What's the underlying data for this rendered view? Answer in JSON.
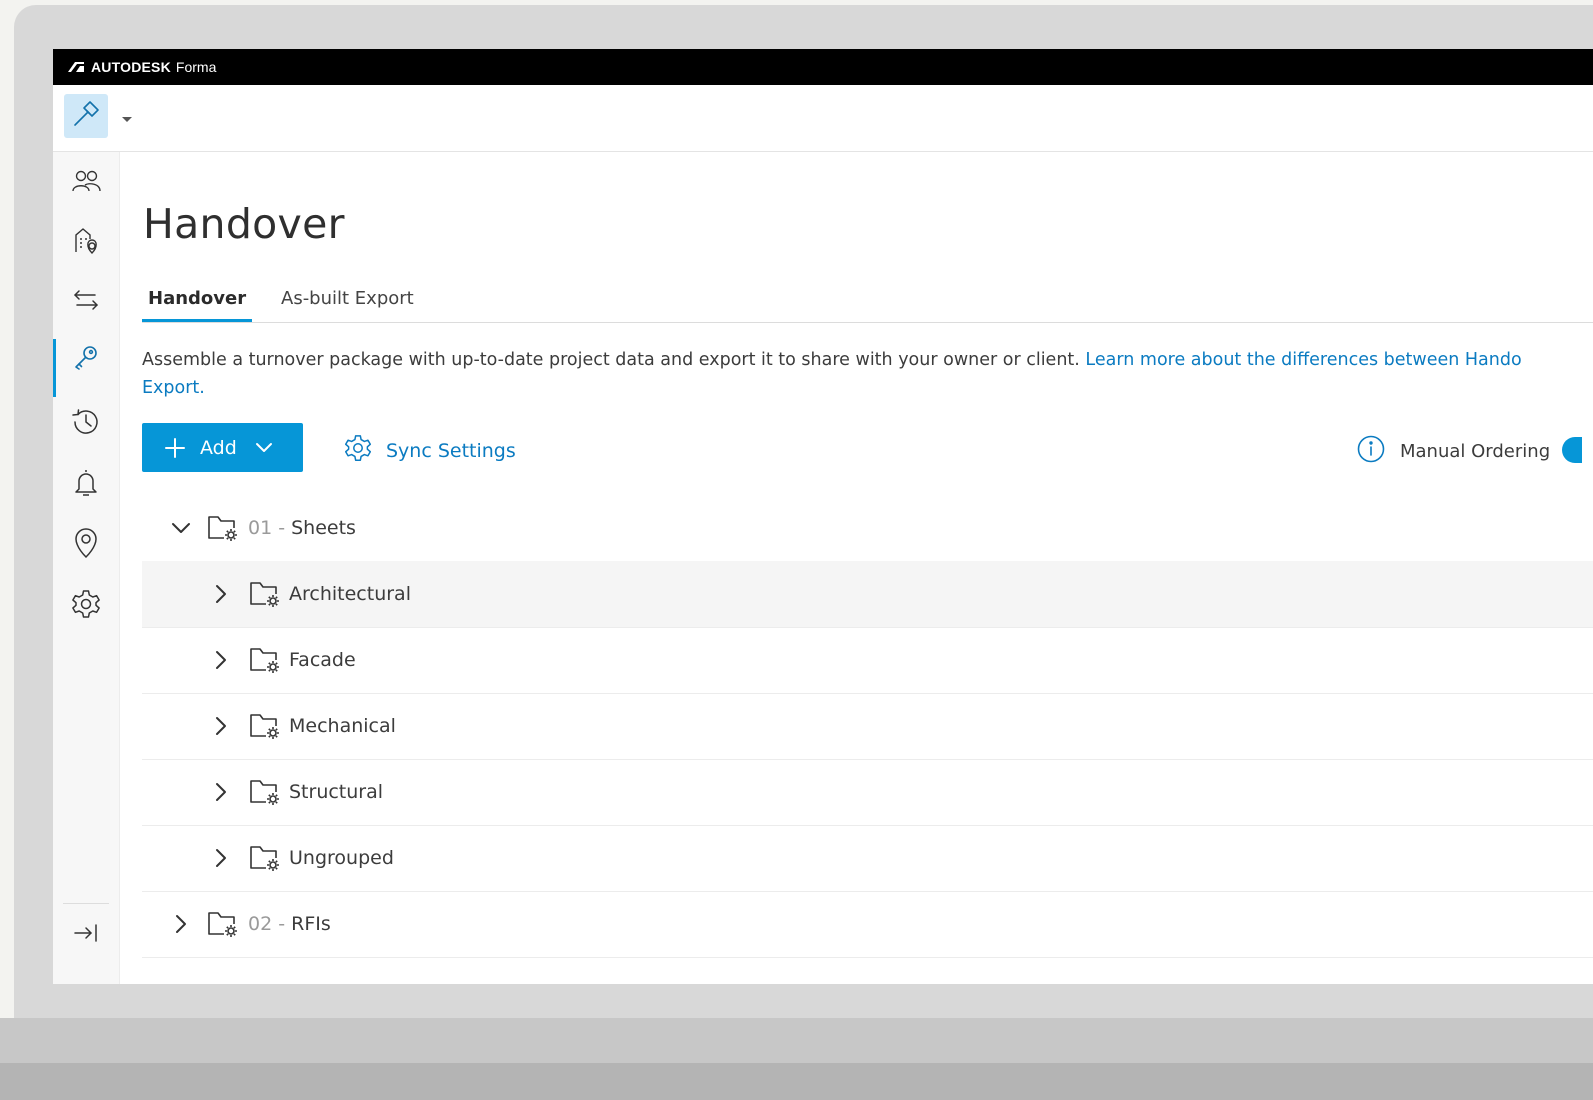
{
  "topbar": {
    "brand": "AUTODESK",
    "product": "Forma"
  },
  "nav": {
    "items": [
      {
        "name": "members-icon"
      },
      {
        "name": "project-location-icon"
      },
      {
        "name": "transfer-icon"
      },
      {
        "name": "handover-key-icon",
        "active": true
      },
      {
        "name": "history-icon"
      },
      {
        "name": "notifications-bell-icon"
      },
      {
        "name": "location-pin-icon"
      },
      {
        "name": "settings-gear-icon"
      }
    ],
    "collapse_icon": "collapse-sidebar-icon"
  },
  "page": {
    "title": "Handover",
    "tabs": [
      {
        "label": "Handover",
        "active": true
      },
      {
        "label": "As-built Export",
        "active": false
      }
    ],
    "description": "Assemble a turnover package with up-to-date project data and export it to share with your owner or client.",
    "description_link_line1": "Learn more about the differences between Hando",
    "description_link_line2": "Export."
  },
  "toolbar": {
    "add_label": "Add",
    "sync_label": "Sync Settings",
    "ordering_label": "Manual Ordering"
  },
  "tree": {
    "sheets": {
      "num": "01",
      "sep": " - ",
      "name": "Sheets",
      "expanded": true
    },
    "children": [
      "Architectural",
      "Facade",
      "Mechanical",
      "Structural",
      "Ungrouped"
    ],
    "rfis": {
      "num": "02",
      "sep": " - ",
      "name": "RFIs",
      "expanded": false
    }
  },
  "colors": {
    "accent": "#0696d7",
    "link": "#0b7bc1",
    "tile": "#cfe8f8"
  }
}
